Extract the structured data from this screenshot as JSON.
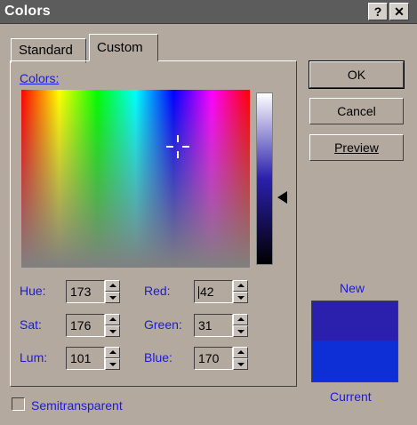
{
  "window": {
    "title": "Colors",
    "help_label": "?",
    "close_label": "✕"
  },
  "tabs": [
    {
      "label": "Standard",
      "selected": false
    },
    {
      "label": "Custom",
      "selected": true
    }
  ],
  "colors_label": "Colors:",
  "fields": {
    "hue": {
      "label": "Hue:",
      "value": "173"
    },
    "sat": {
      "label": "Sat:",
      "value": "176"
    },
    "lum": {
      "label": "Lum:",
      "value": "101"
    },
    "red": {
      "label": "Red:",
      "value": "42"
    },
    "green": {
      "label": "Green:",
      "value": "31"
    },
    "blue": {
      "label": "Blue:",
      "value": "170"
    }
  },
  "buttons": {
    "ok": "OK",
    "cancel": "Cancel",
    "preview": "Preview"
  },
  "preview": {
    "new_label": "New",
    "current_label": "Current",
    "new_color": "#2b1fad",
    "current_color": "#0e2fd6"
  },
  "semitransparent": {
    "label": "Semitransparent",
    "checked": false
  },
  "icons": {
    "help": "help-icon",
    "close": "close-icon",
    "up": "up-arrow-icon",
    "down": "down-arrow-icon",
    "lum_pointer": "triangle-pointer-icon",
    "crosshair": "crosshair-icon"
  }
}
